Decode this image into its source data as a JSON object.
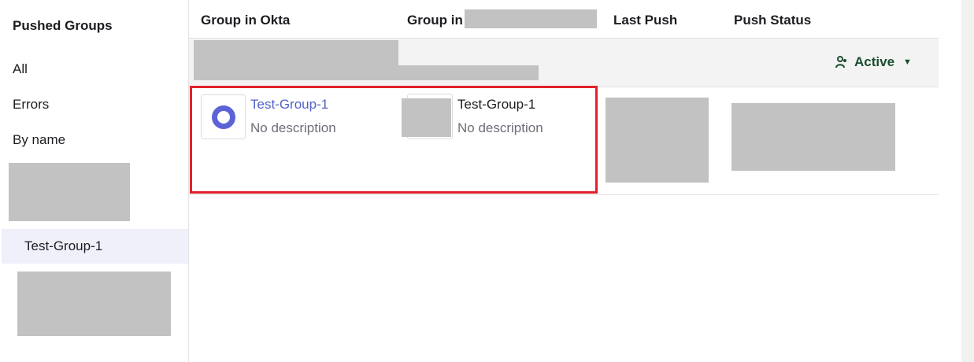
{
  "sidebar": {
    "title": "Pushed Groups",
    "filters": [
      {
        "label": "All"
      },
      {
        "label": "Errors"
      },
      {
        "label": "By name"
      }
    ],
    "selected_group": "Test-Group-1"
  },
  "table": {
    "columns": [
      "Group in Okta",
      "Group in",
      "Last Push",
      "Push Status"
    ],
    "status_filter": {
      "label": "Active",
      "icon": "user-group-icon"
    },
    "rows": [
      {
        "okta_group": {
          "name": "Test-Group-1",
          "description": "No description",
          "icon": "okta-ring-icon"
        },
        "target_group": {
          "name": "Test-Group-1",
          "description": "No description"
        }
      }
    ]
  },
  "colors": {
    "link": "#5361c7",
    "status_green": "#1a4d2e",
    "highlight_red": "#e2202b",
    "okta_blue": "#5d63d7",
    "redacted": "#c2c2c2"
  }
}
